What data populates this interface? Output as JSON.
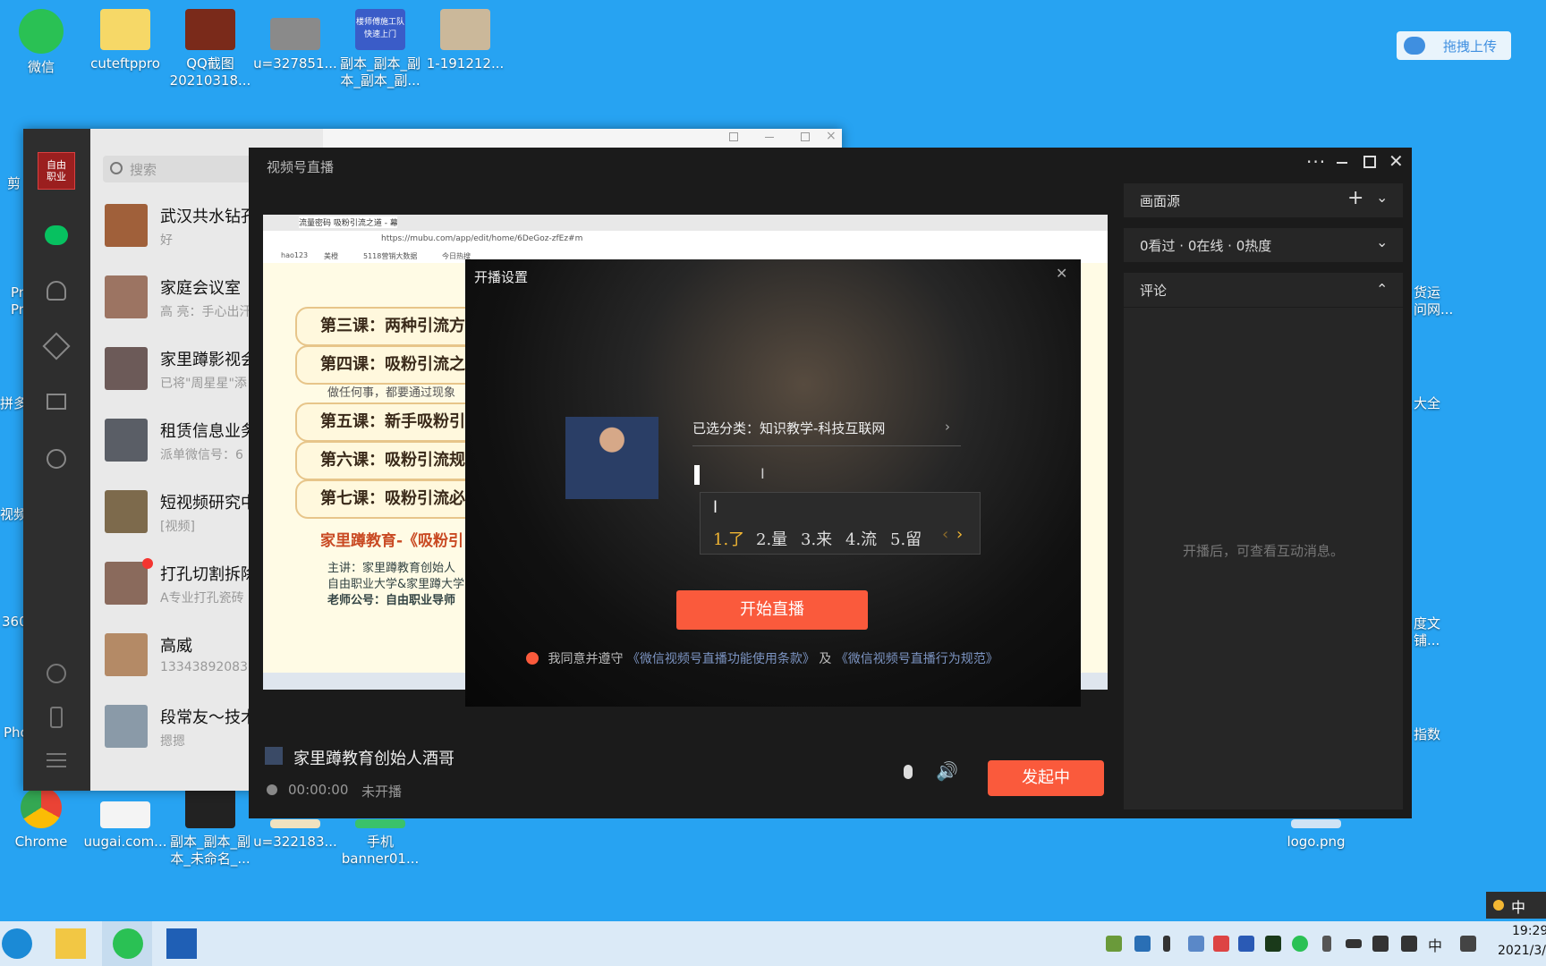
{
  "desktop": {
    "icons_top": [
      {
        "label": "微信"
      },
      {
        "label": "cuteftppro"
      },
      {
        "label": "QQ截图\n20210318..."
      },
      {
        "label": "u=327851..."
      },
      {
        "label": "副本_副本_副\n本_副本_副...",
        "thumb_text": "楼师傅施工队\n快速上门"
      },
      {
        "label": "1-191212..."
      }
    ],
    "icons_bottom": [
      {
        "label": "Chrome"
      },
      {
        "label": "uugai.com..."
      },
      {
        "label": "副本_副本_副\n本_未命名_..."
      },
      {
        "label": "u=322183..."
      },
      {
        "label": "手机\nbanner01..."
      },
      {
        "label": "logo.png"
      }
    ],
    "left_fragments": [
      "剪",
      "Pr\nPr",
      "拼多",
      "视频",
      "360",
      "Pho"
    ],
    "right_fragments": [
      "货运\n问网...",
      "大全",
      "度文\n铺...",
      "指数"
    ],
    "upload_button": "拖拽上传"
  },
  "wechat": {
    "search_placeholder": "搜索",
    "avatar_text": "自由\n职业",
    "chats": [
      {
        "name": "武汉共水钻孔",
        "preview": "好"
      },
      {
        "name": "家庭会议室",
        "preview": "高 亮：手心出汗"
      },
      {
        "name": "家里蹲影视会",
        "preview": "已将\"周星星\"添"
      },
      {
        "name": "租赁信息业务",
        "preview": "派单微信号：6"
      },
      {
        "name": "短视频研究中",
        "preview": "[视频]"
      },
      {
        "name": "打孔切割拆除",
        "preview": "A专业打孔瓷砖"
      },
      {
        "name": "高威",
        "preview": "13343892083"
      },
      {
        "name": "段常友～技术",
        "preview": "摁摁"
      }
    ]
  },
  "live": {
    "title": "视频号直播",
    "panel": {
      "source_label": "画面源",
      "stats": "0看过 · 0在线 · 0热度",
      "comments_label": "评论",
      "comments_empty": "开播后，可查看互动消息。"
    },
    "browser": {
      "url": "https://mubu.com/app/edit/home/6DeGoz-zfEz#m",
      "tab_title": "流量密码 吸粉引流之道 - 幕布",
      "bookmarks": [
        "hao123",
        "美橙",
        "5118营销大数据",
        "今日热搜"
      ],
      "lessons": [
        "第三课：两种引流方",
        "第四课：吸粉引流之",
        "第五课：新手吸粉引",
        "第六课：吸粉引流规",
        "第七课：吸粉引流必"
      ],
      "lesson_note": "做任何事，都要通过现象",
      "book_title": "家里蹲教育-《吸粉引",
      "credits": [
        "主讲：家里蹲教育创始人",
        "自由职业大学&家里蹲大学",
        "老师公号：自由职业导师"
      ]
    },
    "modal": {
      "title": "开播设置",
      "category": "已选分类：知识教学-科技互联网",
      "ime_input": "l",
      "candidates": [
        "1.了",
        "2.量",
        "3.来",
        "4.流",
        "5.留"
      ],
      "start_button": "开始直播",
      "agree_prefix": "我同意并遵守",
      "agree_link1": "《微信视频号直播功能使用条款》",
      "agree_mid": "及",
      "agree_link2": "《微信视频号直播行为规范》"
    },
    "host_name": "家里蹲教育创始人酒哥",
    "timer": "00:00:00",
    "status": "未开播",
    "launch_button": "发起中"
  },
  "taskbar": {
    "ime": "中",
    "time": "19:29",
    "date": "2021/3/"
  },
  "colors": {
    "desktop": "#27a3f2",
    "accent": "#fa5a3c",
    "live_bg": "#1b1b1b"
  }
}
